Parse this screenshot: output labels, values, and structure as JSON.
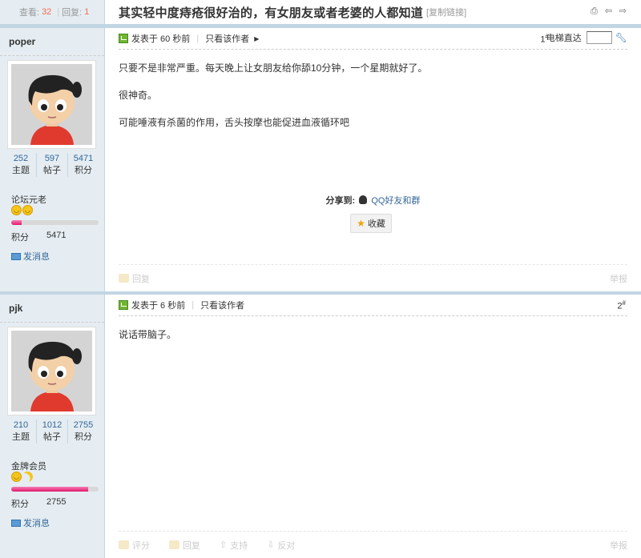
{
  "header": {
    "views_label": "查看:",
    "views": "32",
    "sep": "|",
    "replies_label": "回复:",
    "replies": "1",
    "title": "其实轻中度痔疮很好治的，有女朋友或者老婆的人都知道",
    "copy_link": "[复制链接]",
    "icons": [
      "print-icon",
      "prev-icon",
      "next-icon"
    ]
  },
  "posts": [
    {
      "username": "poper",
      "stats": [
        {
          "num": "252",
          "label": "主题"
        },
        {
          "num": "597",
          "label": "帖子"
        },
        {
          "num": "5471",
          "label": "积分"
        }
      ],
      "rank": "论坛元老",
      "progress_fraction": 0.12,
      "score_label": "积分",
      "score": "5471",
      "message": "发消息",
      "posted": "发表于 60 秒前",
      "only_author": "只看该作者",
      "floor": "1",
      "floor_sup": "#",
      "jump_label": "电梯直达",
      "content": [
        "只要不是非常严重。每天晚上让女朋友给你舔10分钟，一个星期就好了。",
        "很神奇。",
        "可能唾液有杀菌的作用，舌头按摩也能促进血液循环吧"
      ],
      "share_label": "分享到:",
      "share_target": "QQ好友和群",
      "favorite": "收藏",
      "footer": {
        "reply": "回复",
        "report": "举报"
      }
    },
    {
      "username": "pjk",
      "stats": [
        {
          "num": "210",
          "label": "主题"
        },
        {
          "num": "1012",
          "label": "帖子"
        },
        {
          "num": "2755",
          "label": "积分"
        }
      ],
      "rank": "金牌会员",
      "progress_fraction": 0.88,
      "score_label": "积分",
      "score": "2755",
      "message": "发消息",
      "posted": "发表于 6 秒前",
      "only_author": "只看该作者",
      "floor": "2",
      "floor_sup": "#",
      "content": [
        "说话带脑子。"
      ],
      "footer": {
        "rate": "评分",
        "reply": "回复",
        "support": "支持",
        "oppose": "反对",
        "report": "举报"
      }
    }
  ],
  "colors": {
    "sidebar_bg": "#e5edf2",
    "border": "#c2d5e3",
    "link": "#336699",
    "accent_red": "#f26c4f",
    "progress": "#e2186a"
  }
}
